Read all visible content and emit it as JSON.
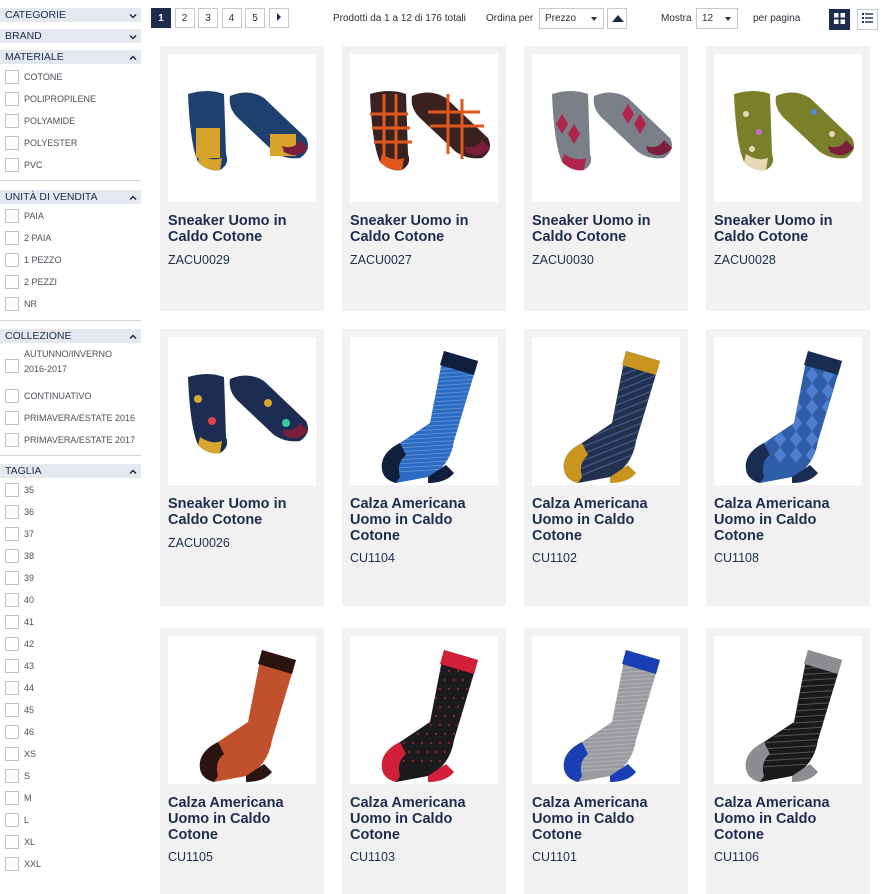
{
  "sidebar": {
    "categorie": {
      "title": "CATEGORIE"
    },
    "brand": {
      "title": "BRAND"
    },
    "materiale": {
      "title": "MATERIALE",
      "options": [
        "COTONE",
        "POLIPROPILENE",
        "POLYAMIDE",
        "POLYESTER",
        "PVC"
      ]
    },
    "unita": {
      "title": "UNITÀ DI VENDITA",
      "options": [
        "PAIA",
        "2 PAIA",
        "1 PEZZO",
        "2 PEZZI",
        "NR"
      ]
    },
    "collezione": {
      "title": "COLLEZIONE",
      "options": [
        "AUTUNNO/INVERNO 2016-2017",
        "CONTINUATIVO",
        "PRIMAVERA/ESTATE 2016",
        "PRIMAVERA/ESTATE 2017"
      ]
    },
    "taglia": {
      "title": "TAGLIA",
      "options": [
        "35",
        "36",
        "37",
        "38",
        "39",
        "40",
        "41",
        "42",
        "43",
        "44",
        "45",
        "46",
        "XS",
        "S",
        "M",
        "L",
        "XL",
        "XXL"
      ]
    }
  },
  "toolbar": {
    "pages": [
      "1",
      "2",
      "3",
      "4",
      "5"
    ],
    "current_page": "1",
    "next_icon": "chevron-right-icon",
    "results_text": "Prodotti da 1 a 12 di 176 totali",
    "sort_label": "Ordina per",
    "sort_value": "Prezzo",
    "sort_direction_icon": "sort-ascending-icon",
    "show_label": "Mostra",
    "show_value": "12",
    "per_page_label": "per pagina",
    "view_modes": [
      "grid-view-icon",
      "list-view-icon"
    ],
    "active_view": "grid"
  },
  "products": [
    {
      "name": "Sneaker Uomo in Caldo Cotone",
      "code": "ZACU0029",
      "type": "sneaker",
      "base": "#1f3f6e",
      "accent": "#d8a32a",
      "pattern": "blue-yellow"
    },
    {
      "name": "Sneaker Uomo in Caldo Cotone",
      "code": "ZACU0027",
      "type": "sneaker",
      "base": "#3a2220",
      "accent": "#e0571e",
      "pattern": "plaid"
    },
    {
      "name": "Sneaker Uomo in Caldo Cotone",
      "code": "ZACU0030",
      "type": "sneaker",
      "base": "#7b7f88",
      "accent": "#b0254e",
      "pattern": "argyle"
    },
    {
      "name": "Sneaker Uomo in Caldo Cotone",
      "code": "ZACU0028",
      "type": "sneaker",
      "base": "#7a7f2a",
      "accent": "#e7d9b6",
      "pattern": "dots"
    },
    {
      "name": "Sneaker Uomo in Caldo Cotone",
      "code": "ZACU0026",
      "type": "sneaker",
      "base": "#1c2c52",
      "accent": "#d7a830",
      "pattern": "paisley"
    },
    {
      "name": "Calza Americana Uomo in Caldo Cotone",
      "code": "CU1104",
      "type": "sock",
      "base": "#2a6bc4",
      "accent": "#0f1f3c",
      "pattern": "stripes"
    },
    {
      "name": "Calza Americana Uomo in Caldo Cotone",
      "code": "CU1102",
      "type": "sock",
      "base": "#24304f",
      "accent": "#c9951e",
      "pattern": "diagonal"
    },
    {
      "name": "Calza Americana Uomo in Caldo Cotone",
      "code": "CU1108",
      "type": "sock",
      "base": "#2f5da8",
      "accent": "#1a2c52",
      "pattern": "argyle"
    },
    {
      "name": "Calza Americana Uomo in Caldo Cotone",
      "code": "CU1105",
      "type": "sock",
      "base": "#c0512c",
      "accent": "#2a1410",
      "pattern": "check"
    },
    {
      "name": "Calza Americana Uomo in Caldo Cotone",
      "code": "CU1103",
      "type": "sock",
      "base": "#1b1b1d",
      "accent": "#d21f3a",
      "pattern": "dots"
    },
    {
      "name": "Calza Americana Uomo in Caldo Cotone",
      "code": "CU1101",
      "type": "sock",
      "base": "#9a9ba0",
      "accent": "#1a3fb5",
      "pattern": "stripes"
    },
    {
      "name": "Calza Americana Uomo in Caldo Cotone",
      "code": "CU1106",
      "type": "sock",
      "base": "#1a1a1c",
      "accent": "#8c8d91",
      "pattern": "pinstripe"
    }
  ]
}
